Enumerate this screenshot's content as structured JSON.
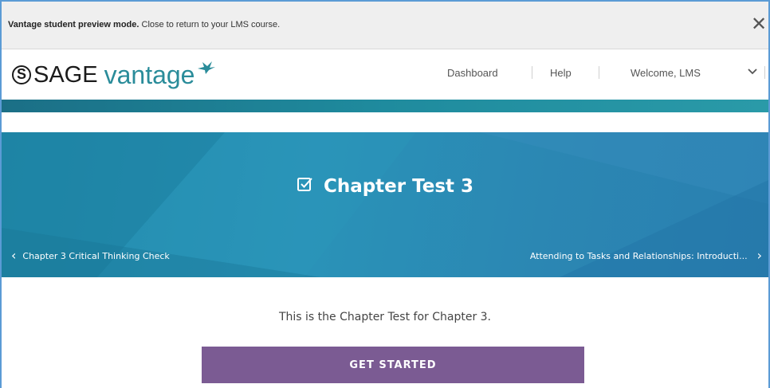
{
  "preview_bar": {
    "bold_text": "Vantage student preview mode.",
    "text": " Close to return to your LMS course.",
    "close_glyph": "✕"
  },
  "header": {
    "logo_sage": "SAGE",
    "logo_s": "S",
    "logo_vantage": "vantage",
    "nav": {
      "dashboard": "Dashboard",
      "help": "Help",
      "welcome": "Welcome, LMS"
    }
  },
  "hero": {
    "title": "Chapter Test 3",
    "prev_label": "Chapter 3 Critical Thinking Check",
    "next_label": "Attending to Tasks and Relationships: Introducti...",
    "prev_arrow": "‹",
    "next_arrow": "›"
  },
  "content": {
    "intro": "This is the Chapter Test for Chapter 3.",
    "button_label": "GET STARTED"
  },
  "colors": {
    "teal": "#1f8b9e",
    "hero_blue": "#2a93b8",
    "button_purple": "#7b5b93"
  },
  "icons": {
    "close": "close-icon",
    "chevron": "chevron-down-icon",
    "checkbox": "checkbox-icon",
    "bird": "bird-logo-icon"
  }
}
